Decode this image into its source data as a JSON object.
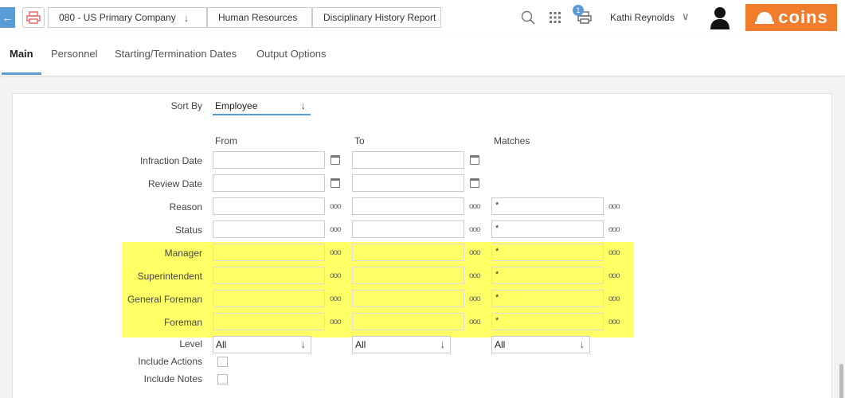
{
  "breadcrumbs": [
    {
      "label": "080 - US Primary Company"
    },
    {
      "label": "Human Resources"
    },
    {
      "label": "Disciplinary History Report"
    }
  ],
  "header": {
    "print_queue_count": "1",
    "user_name": "Kathi Reynolds",
    "logo_text": "coins",
    "logo_color": "#f07c2c",
    "accent_color": "#5b9bd5"
  },
  "tabs": [
    {
      "label": "Main",
      "active": true
    },
    {
      "label": "Personnel",
      "active": false
    },
    {
      "label": "Starting/Termination Dates",
      "active": false
    },
    {
      "label": "Output Options",
      "active": false
    }
  ],
  "form": {
    "sort_by_label": "Sort By",
    "sort_by_value": "Employee",
    "col_from": "From",
    "col_to": "To",
    "col_matches": "Matches",
    "rows": [
      {
        "label": "Infraction Date",
        "from": "",
        "to": "",
        "matches": null
      },
      {
        "label": "Review Date",
        "from": "",
        "to": "",
        "matches": null
      },
      {
        "label": "Reason",
        "from": "",
        "to": "",
        "matches": "*"
      },
      {
        "label": "Status",
        "from": "",
        "to": "",
        "matches": "*"
      },
      {
        "label": "Manager",
        "from": "",
        "to": "",
        "matches": "*"
      },
      {
        "label": "Superintendent",
        "from": "",
        "to": "",
        "matches": "*"
      },
      {
        "label": "General Foreman",
        "from": "",
        "to": "",
        "matches": "*"
      },
      {
        "label": "Foreman",
        "from": "",
        "to": "",
        "matches": "*"
      }
    ],
    "level_label": "Level",
    "level_from": "All",
    "level_to": "All",
    "level_matches": "All",
    "include_actions_label": "Include Actions",
    "include_notes_label": "Include Notes",
    "highlight_color": "#ffff66"
  }
}
